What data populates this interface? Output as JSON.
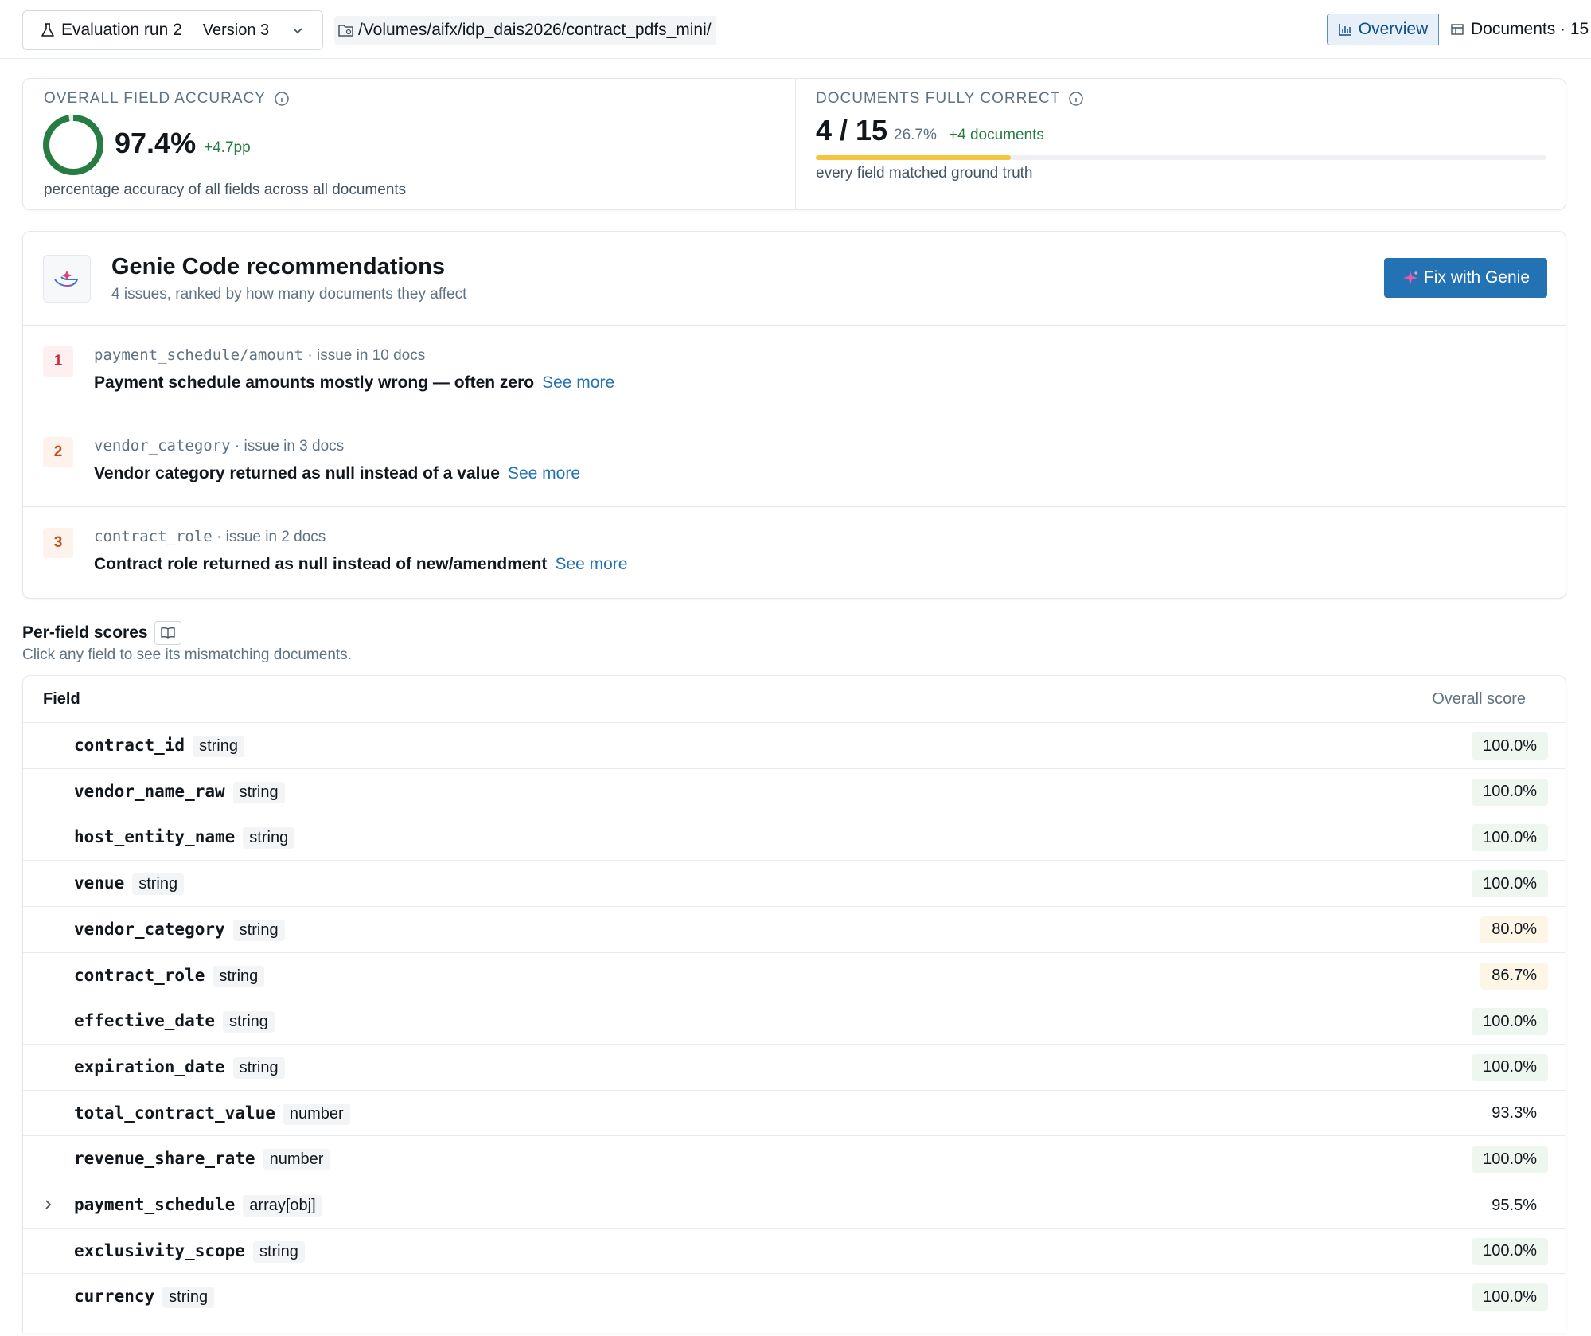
{
  "topbar": {
    "run_name": "Evaluation run 2",
    "version": "Version 3",
    "path": "/Volumes/aifx/idp_dais2026/contract_pdfs_mini/",
    "tabs": {
      "overview": "Overview",
      "documents": "Documents · 15"
    }
  },
  "metrics": {
    "accuracy": {
      "label": "OVERALL FIELD ACCURACY",
      "value": "97.4%",
      "value_fraction": 0.974,
      "delta": "+4.7pp",
      "caption": "percentage accuracy of all fields across all documents",
      "ring_color": "#277c43"
    },
    "fully_correct": {
      "label": "DOCUMENTS FULLY CORRECT",
      "value": "4 / 15",
      "percent": "26.7%",
      "delta": "+4 documents",
      "caption": "every field matched ground truth",
      "bar_fraction": 0.267,
      "bar_color": "#f6c43e"
    }
  },
  "genie": {
    "title": "Genie Code recommendations",
    "subtitle": "4 issues, ranked by how many documents they affect",
    "fix_button": "Fix with Genie",
    "see_more": "See more",
    "issues": [
      {
        "rank": "1",
        "field": "payment_schedule/amount",
        "count": "· issue in 10 docs",
        "headline": "Payment schedule amounts mostly wrong — often zero",
        "rank_color": "#c72a3a",
        "rank_bg": "#fdf0f1"
      },
      {
        "rank": "2",
        "field": "vendor_category",
        "count": "· issue in 3 docs",
        "headline": "Vendor category returned as null instead of a value",
        "rank_color": "#be501e",
        "rank_bg": "#fdf3ec"
      },
      {
        "rank": "3",
        "field": "contract_role",
        "count": "· issue in 2 docs",
        "headline": "Contract role returned as null instead of new/amendment",
        "rank_color": "#be501e",
        "rank_bg": "#fdf3ec"
      }
    ]
  },
  "per_field": {
    "title": "Per-field scores",
    "subtitle": "Click any field to see its mismatching documents.",
    "headers": {
      "field": "Field",
      "score": "Overall score"
    },
    "rows": [
      {
        "name": "contract_id",
        "type": "string",
        "score": "100.0%",
        "level": "good"
      },
      {
        "name": "vendor_name_raw",
        "type": "string",
        "score": "100.0%",
        "level": "good"
      },
      {
        "name": "host_entity_name",
        "type": "string",
        "score": "100.0%",
        "level": "good"
      },
      {
        "name": "venue",
        "type": "string",
        "score": "100.0%",
        "level": "good"
      },
      {
        "name": "vendor_category",
        "type": "string",
        "score": "80.0%",
        "level": "warn"
      },
      {
        "name": "contract_role",
        "type": "string",
        "score": "86.7%",
        "level": "warn"
      },
      {
        "name": "effective_date",
        "type": "string",
        "score": "100.0%",
        "level": "good"
      },
      {
        "name": "expiration_date",
        "type": "string",
        "score": "100.0%",
        "level": "good"
      },
      {
        "name": "total_contract_value",
        "type": "number",
        "score": "93.3%",
        "level": "plain"
      },
      {
        "name": "revenue_share_rate",
        "type": "number",
        "score": "100.0%",
        "level": "good"
      },
      {
        "name": "payment_schedule",
        "type": "array[obj]",
        "score": "95.5%",
        "level": "plain",
        "expandable": true
      },
      {
        "name": "exclusivity_scope",
        "type": "string",
        "score": "100.0%",
        "level": "good"
      },
      {
        "name": "currency",
        "type": "string",
        "score": "100.0%",
        "level": "good"
      }
    ]
  },
  "colors": {
    "accent": "#2272b4",
    "good_bg": "#eef7ef",
    "warn_bg": "#fdf5e6"
  }
}
